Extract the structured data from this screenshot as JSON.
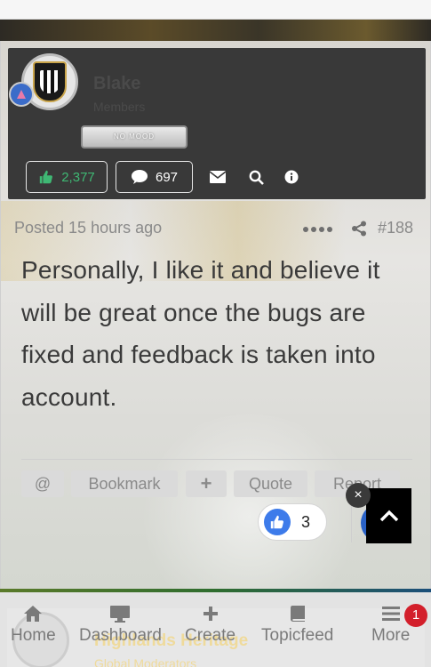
{
  "author": {
    "name": "Blake",
    "group": "Members",
    "mood": "NO MOOD",
    "reputation": "2,377",
    "post_count": "697",
    "icons": [
      "thumbs-up-icon",
      "comment-icon",
      "envelope-icon",
      "search-icon",
      "info-icon"
    ]
  },
  "post": {
    "posted": "Posted 15 hours ago",
    "number": "#188",
    "body": "Personally, I like it and believe it will be great once the bugs are fixed and feedback is taken into account.",
    "reaction_count": "3"
  },
  "controls": {
    "mention": "@",
    "bookmark": "Bookmark",
    "plus": "+",
    "quote": "Quote",
    "report": "Report"
  },
  "overlay": {
    "close": "×"
  },
  "next_post": {
    "name": "Highlands Heritage",
    "group": "Global Moderators"
  },
  "nav": {
    "items": [
      {
        "label": "Home",
        "icon": "home-icon"
      },
      {
        "label": "Dashboard",
        "icon": "monitor-icon"
      },
      {
        "label": "Create",
        "icon": "plus-icon"
      },
      {
        "label": "Topicfeed",
        "icon": "book-icon"
      },
      {
        "label": "More",
        "icon": "menu-icon"
      }
    ],
    "badge": "1"
  },
  "colors": {
    "reputation_green": "#3fb874",
    "like_blue": "#3d7bea",
    "badge_red": "#d31f2b",
    "panel_dark": "#393939"
  }
}
